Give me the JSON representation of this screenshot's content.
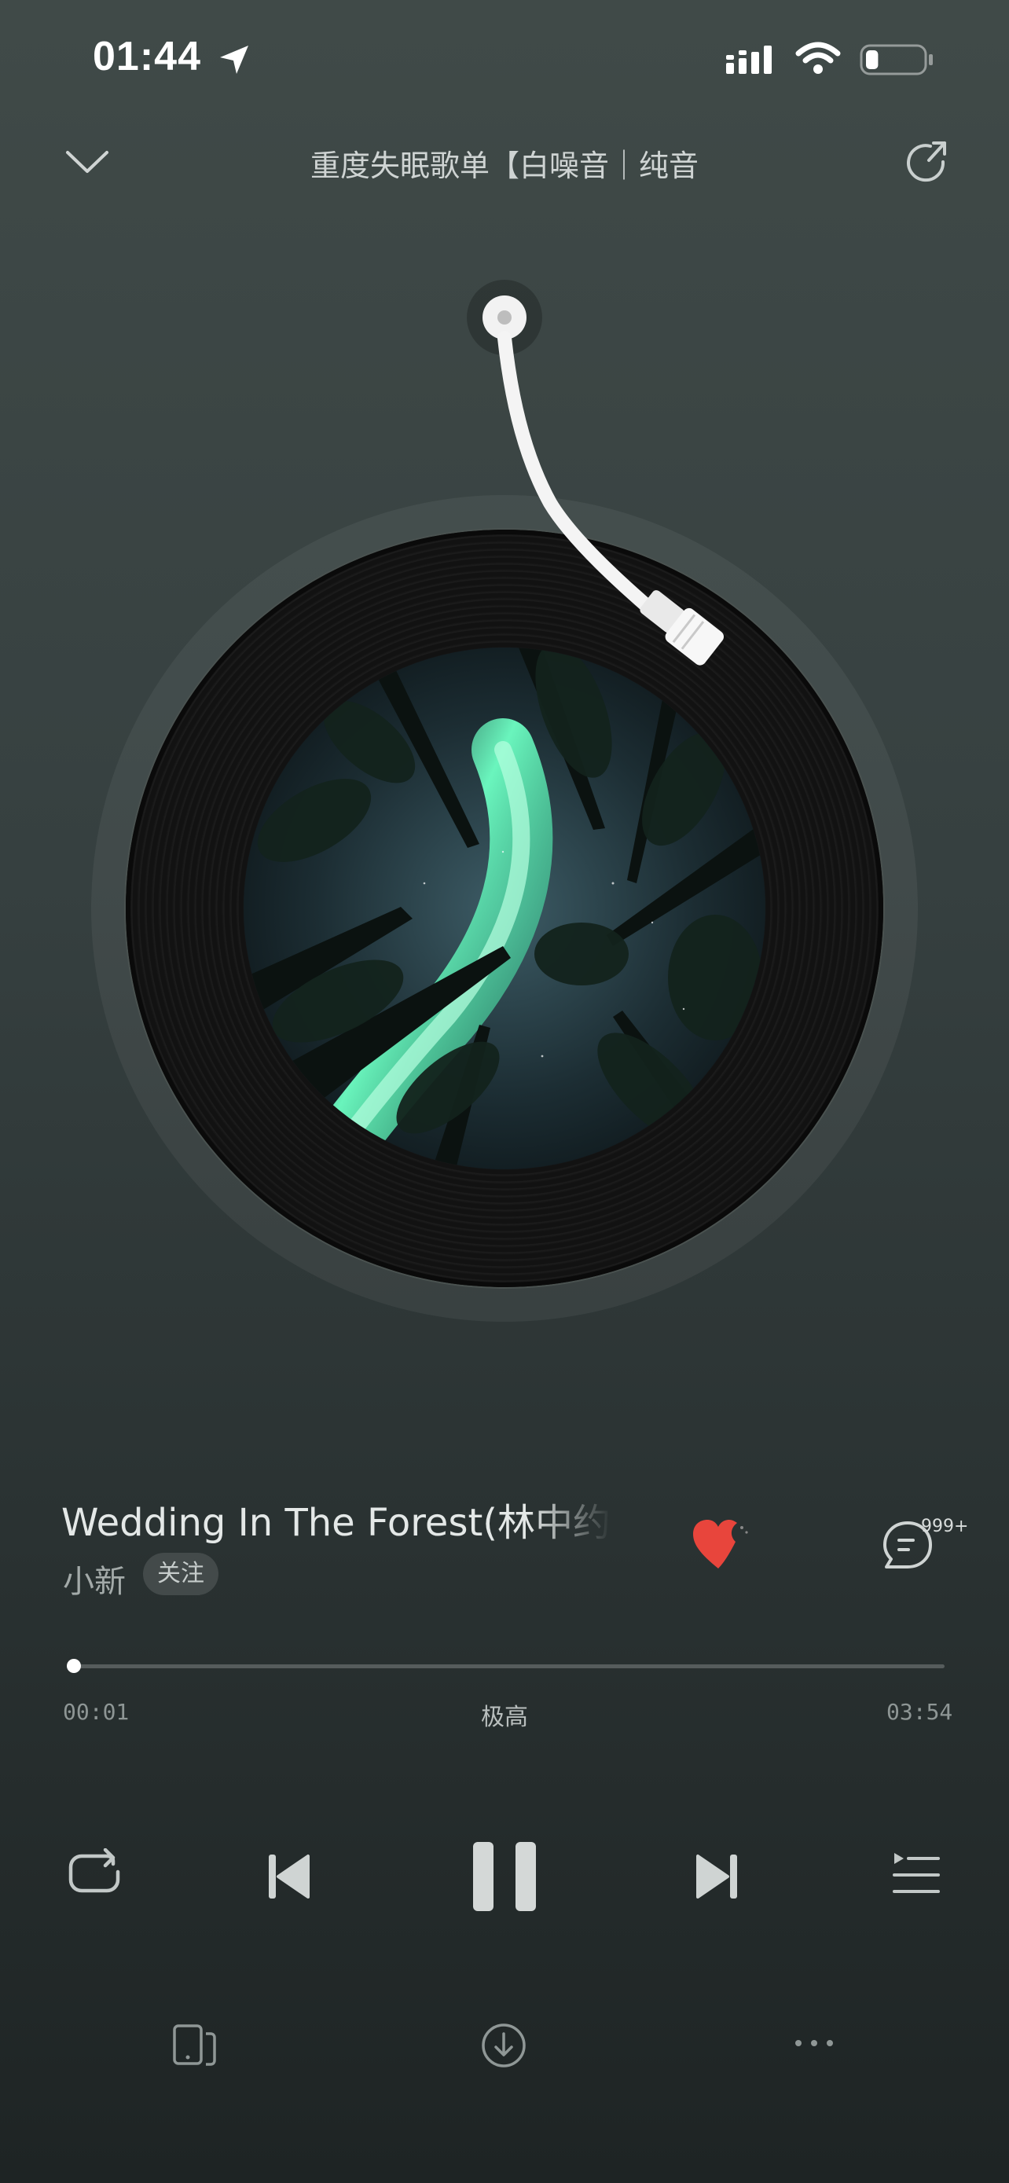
{
  "status_bar": {
    "time": "01:44",
    "icons": [
      "location-arrow-icon",
      "signal-icon",
      "wifi-icon",
      "battery-icon"
    ],
    "battery_level": 0.22
  },
  "header": {
    "playlist_title": "重度失眠歌单【白噪音｜纯音",
    "icons": [
      "chevron-down-icon",
      "share-icon"
    ]
  },
  "song": {
    "title": "Wedding In The Forest(林中约",
    "artist": "小新",
    "follow_label": "关注",
    "liked": true,
    "comment_count": "999+"
  },
  "progress": {
    "elapsed": "00:01",
    "total": "03:54",
    "quality": "极高",
    "fraction": 0.004
  },
  "controls": {
    "icons": [
      "repeat-icon",
      "previous-icon",
      "pause-icon",
      "next-icon",
      "playlist-icon"
    ]
  },
  "bottom_actions": {
    "icons": [
      "device-icon",
      "download-icon",
      "more-icon"
    ]
  },
  "colors": {
    "background_top": "#404a48",
    "background_bottom": "#1e2424",
    "like_red": "#e8453c"
  }
}
